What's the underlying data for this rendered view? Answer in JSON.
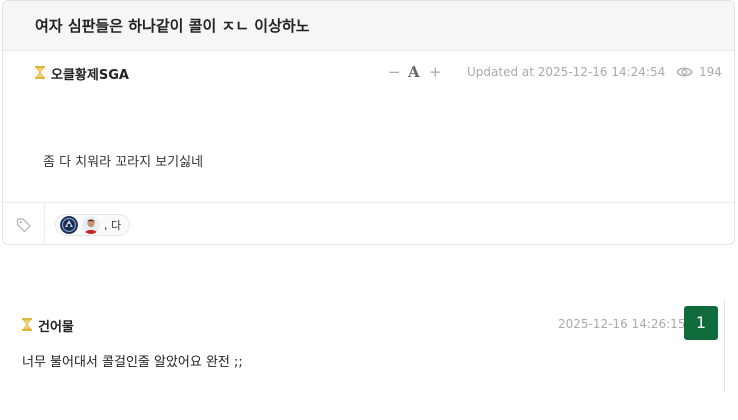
{
  "post": {
    "title": "여자 심판들은 하나같이 콜이 ㅈㄴ 이상하노",
    "author": "오클황제SGA",
    "font_controls": {
      "decrease": "−",
      "font": "A",
      "increase": "+"
    },
    "updated_at": "Updated at 2025-12-16 14:24:54",
    "views": "194",
    "body": "좀 다 치워라 꼬라지 보기싫네",
    "reaction": {
      "text": ", 다"
    }
  },
  "comment": {
    "author": "건어물",
    "time": "2025-12-16 14:26:15",
    "number": "1",
    "text": "너무 불어대서 콜걸인줄 알았어요 완전 ;;"
  },
  "colors": {
    "accent_green": "#0f6b3c",
    "hourglass_gold": "#e2b93b",
    "meta_gray": "#aaaaaa"
  }
}
